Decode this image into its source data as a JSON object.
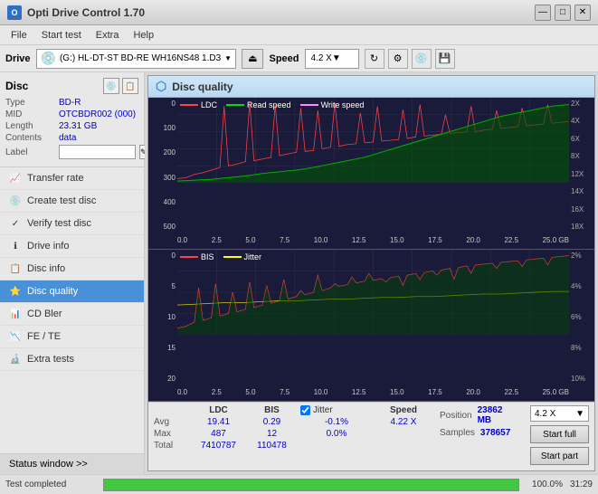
{
  "window": {
    "title": "Opti Drive Control 1.70",
    "min_btn": "—",
    "max_btn": "□",
    "close_btn": "✕"
  },
  "menu": {
    "items": [
      "File",
      "Start test",
      "Extra",
      "Help"
    ]
  },
  "drive_bar": {
    "label": "Drive",
    "drive_value": "(G:) HL-DT-ST BD-RE  WH16NS48 1.D3",
    "speed_label": "Speed",
    "speed_value": "4.2 X"
  },
  "disc": {
    "title": "Disc",
    "type_label": "Type",
    "type_value": "BD-R",
    "mid_label": "MID",
    "mid_value": "OTCBDR002 (000)",
    "length_label": "Length",
    "length_value": "23.31 GB",
    "contents_label": "Contents",
    "contents_value": "data",
    "label_label": "Label",
    "label_value": ""
  },
  "nav": {
    "items": [
      {
        "id": "transfer-rate",
        "label": "Transfer rate",
        "icon": "📈"
      },
      {
        "id": "create-test-disc",
        "label": "Create test disc",
        "icon": "💿"
      },
      {
        "id": "verify-test-disc",
        "label": "Verify test disc",
        "icon": "✓"
      },
      {
        "id": "drive-info",
        "label": "Drive info",
        "icon": "ℹ"
      },
      {
        "id": "disc-info",
        "label": "Disc info",
        "icon": "📋"
      },
      {
        "id": "disc-quality",
        "label": "Disc quality",
        "icon": "⭐",
        "active": true
      },
      {
        "id": "cd-bler",
        "label": "CD Bler",
        "icon": "📊"
      },
      {
        "id": "fe-te",
        "label": "FE / TE",
        "icon": "📉"
      },
      {
        "id": "extra-tests",
        "label": "Extra tests",
        "icon": "🔬"
      }
    ]
  },
  "status_window": {
    "label": "Status window >> "
  },
  "disc_quality": {
    "title": "Disc quality",
    "chart1": {
      "legend": [
        {
          "label": "LDC",
          "color": "#ff4444"
        },
        {
          "label": "Read speed",
          "color": "#00dd00"
        },
        {
          "label": "Write speed",
          "color": "#ff88ff"
        }
      ],
      "y_axis_left": [
        "0",
        "100",
        "200",
        "300",
        "400",
        "500"
      ],
      "y_axis_right": [
        "2X",
        "4X",
        "6X",
        "8X",
        "12X",
        "14X",
        "16X",
        "18X"
      ],
      "x_axis": [
        "0.0",
        "2.5",
        "5.0",
        "7.5",
        "10.0",
        "12.5",
        "15.0",
        "17.5",
        "20.0",
        "22.5",
        "25.0 GB"
      ]
    },
    "chart2": {
      "legend": [
        {
          "label": "BIS",
          "color": "#ff4444"
        },
        {
          "label": "Jitter",
          "color": "#ffff00"
        }
      ],
      "y_axis_left": [
        "0",
        "5",
        "10",
        "15",
        "20"
      ],
      "y_axis_right": [
        "2%",
        "4%",
        "6%",
        "8%",
        "10%"
      ],
      "x_axis": [
        "0.0",
        "2.5",
        "5.0",
        "7.5",
        "10.0",
        "12.5",
        "15.0",
        "17.5",
        "20.0",
        "22.5",
        "25.0 GB"
      ]
    }
  },
  "stats": {
    "headers": [
      "",
      "LDC",
      "BIS",
      "",
      "Jitter",
      "Speed"
    ],
    "avg_label": "Avg",
    "avg_ldc": "19.41",
    "avg_bis": "0.29",
    "avg_jitter": "-0.1%",
    "avg_speed": "4.22 X",
    "max_label": "Max",
    "max_ldc": "487",
    "max_bis": "12",
    "max_jitter": "0.0%",
    "total_label": "Total",
    "total_ldc": "7410787",
    "total_bis": "110478",
    "position_label": "Position",
    "position_value": "23862 MB",
    "samples_label": "Samples",
    "samples_value": "378657",
    "speed_select": "4.2 X",
    "jitter_checked": true,
    "jitter_label": "Jitter"
  },
  "buttons": {
    "start_full": "Start full",
    "start_part": "Start part"
  },
  "status_bar": {
    "text": "Test completed",
    "progress": 100,
    "progress_text": "100.0%",
    "time": "31:29"
  }
}
